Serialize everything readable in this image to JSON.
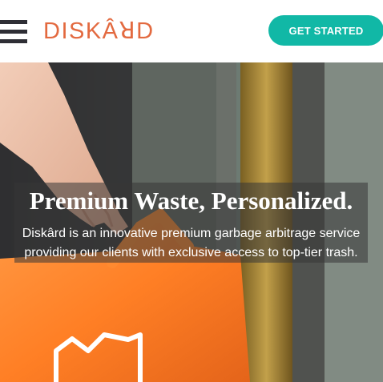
{
  "header": {
    "menu_icon": "hamburger-menu-icon",
    "logo_text": "DISKÂꓤD",
    "cta_label": "GET STARTED"
  },
  "hero": {
    "title": "Premium Waste, Personalized.",
    "subtitle": "Diskârd is an innovative premium garbage arbitrage service providing our clients with exclusive access to top-tier trash."
  },
  "colors": {
    "brand_orange": "#e36a40",
    "cta_teal": "#11b8a6",
    "hamburger": "#2e2e35"
  }
}
